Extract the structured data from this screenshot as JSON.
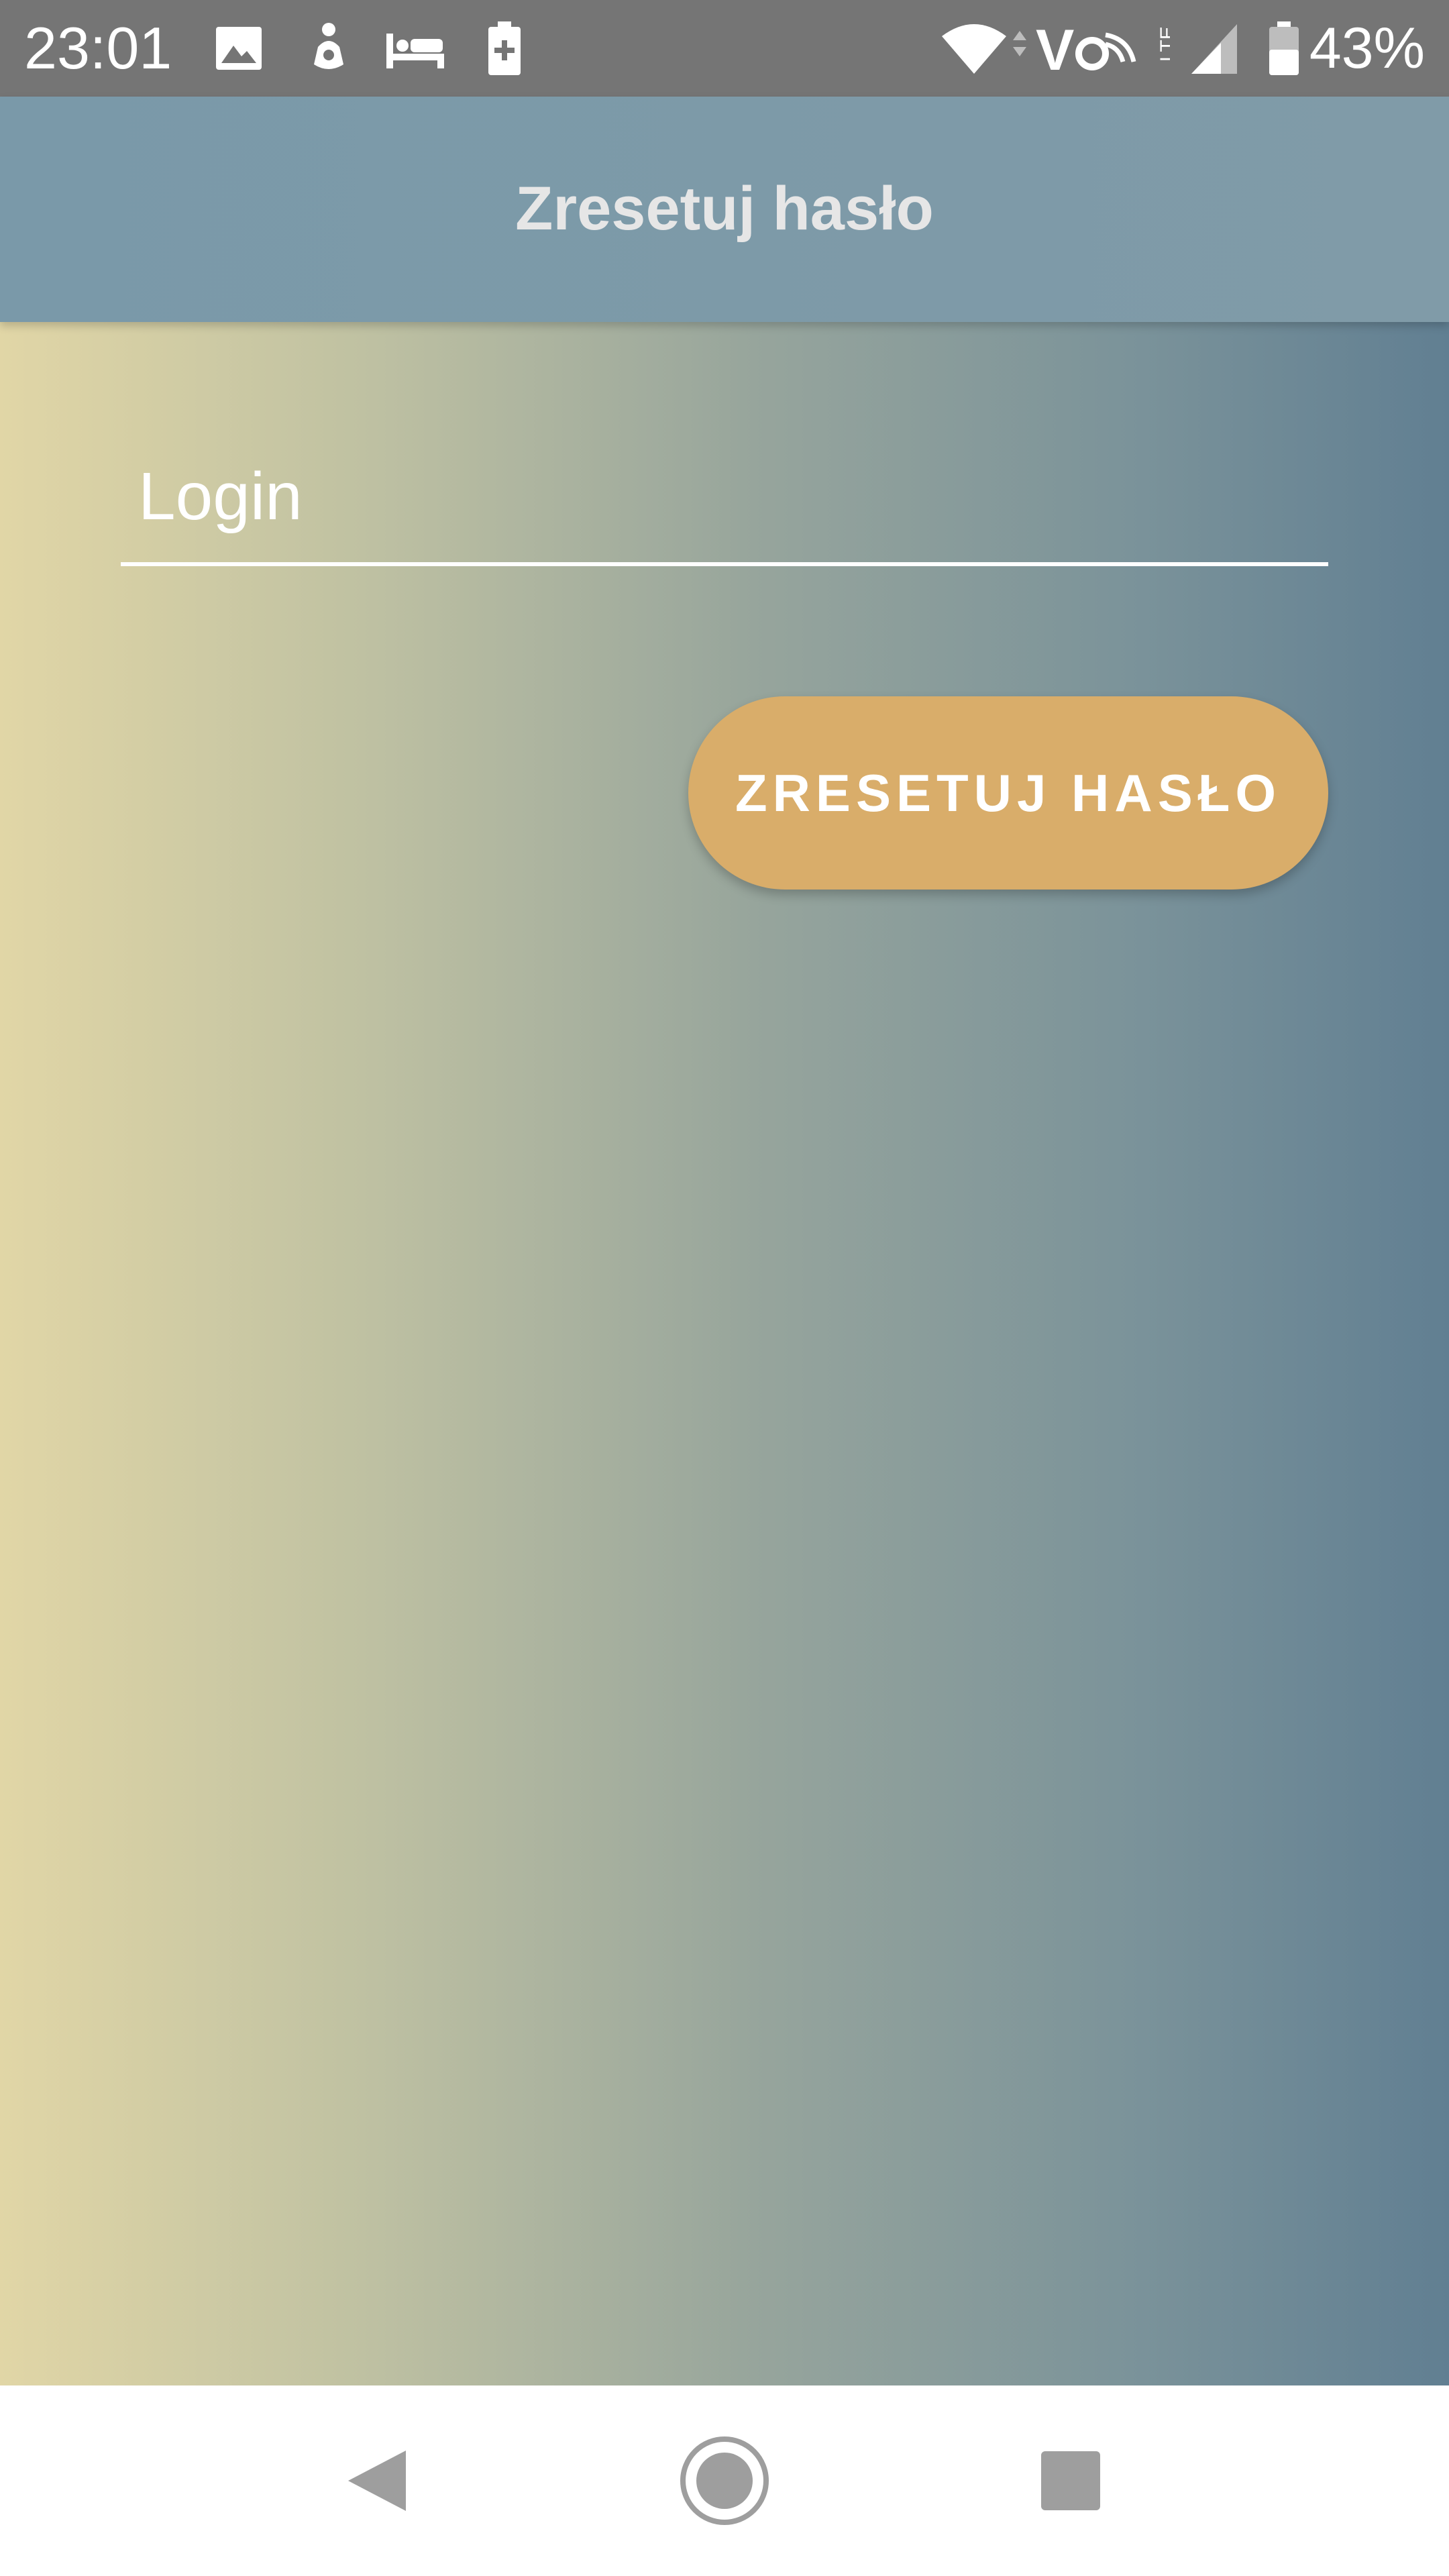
{
  "status_bar": {
    "time": "23:01",
    "battery_percent": "43%",
    "icons": [
      "image-icon",
      "person-icon",
      "bed-icon",
      "battery-plus-icon",
      "wifi-icon",
      "volte-icon",
      "lte-icon",
      "signal-icon",
      "battery-icon"
    ]
  },
  "app_bar": {
    "title": "Zresetuj hasło"
  },
  "form": {
    "login_placeholder": "Login",
    "reset_button_label": "ZRESETUJ HASŁO"
  },
  "nav_bar": {
    "buttons": [
      "back-icon",
      "home-icon",
      "recents-icon"
    ]
  },
  "colors": {
    "status_bar": "#757575",
    "app_bar": "#7a99a9",
    "gradient_left": "#e1d6a6",
    "gradient_right": "#617f92",
    "button": "#d9ad6a"
  }
}
